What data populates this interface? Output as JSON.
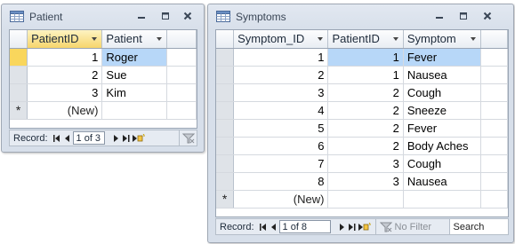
{
  "patient_window": {
    "title": "Patient",
    "icon": "table-icon",
    "columns": [
      "PatientID",
      "Patient"
    ],
    "rows": [
      {
        "id": "1",
        "name": "Roger"
      },
      {
        "id": "2",
        "name": "Sue"
      },
      {
        "id": "3",
        "name": "Kim"
      }
    ],
    "new_row": {
      "marker": "*",
      "id": "(New)"
    },
    "nav": {
      "label": "Record:",
      "record": "1 of 3"
    }
  },
  "symptoms_window": {
    "title": "Symptoms",
    "icon": "table-icon",
    "columns": [
      "Symptom_ID",
      "PatientID",
      "Symptom"
    ],
    "rows": [
      {
        "sid": "1",
        "pid": "1",
        "symptom": "Fever"
      },
      {
        "sid": "2",
        "pid": "1",
        "symptom": "Nausea"
      },
      {
        "sid": "3",
        "pid": "2",
        "symptom": "Cough"
      },
      {
        "sid": "4",
        "pid": "2",
        "symptom": "Sneeze"
      },
      {
        "sid": "5",
        "pid": "2",
        "symptom": "Fever"
      },
      {
        "sid": "6",
        "pid": "2",
        "symptom": "Body Aches"
      },
      {
        "sid": "7",
        "pid": "3",
        "symptom": "Cough"
      },
      {
        "sid": "8",
        "pid": "3",
        "symptom": "Nausea"
      }
    ],
    "new_row": {
      "marker": "*",
      "sid": "(New)"
    },
    "nav": {
      "label": "Record:",
      "record": "1 of 8",
      "filter": "No Filter",
      "search": "Search"
    }
  },
  "colors": {
    "current_row_selector": "#f9d65c",
    "current_cell_highlight": "#b7d7f8",
    "window_frame": "#d7dfea"
  }
}
